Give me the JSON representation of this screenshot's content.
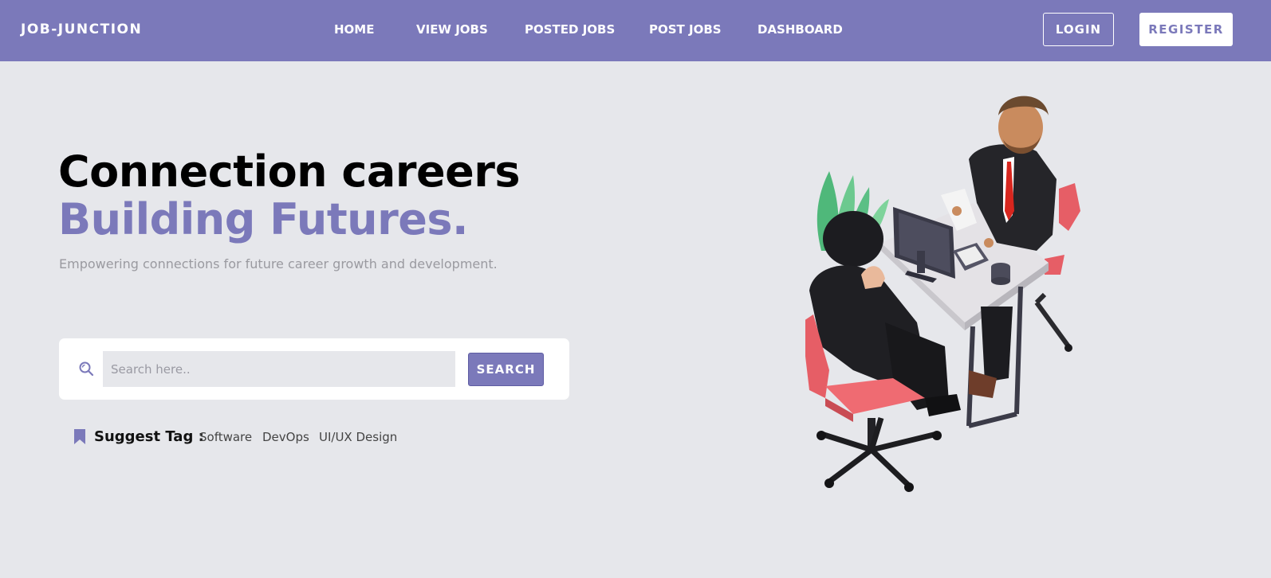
{
  "nav": {
    "brand": "JOB-JUNCTION",
    "links": [
      "HOME",
      "VIEW JOBS",
      "POSTED JOBS",
      "POST JOBS",
      "DASHBOARD"
    ],
    "login_label": "LOGIN",
    "register_label": "REGISTER"
  },
  "hero": {
    "title_line1": "Connection careers",
    "title_line2": "Building Futures.",
    "subtitle": "Empowering connections for future career growth and development."
  },
  "search": {
    "placeholder": "Search here..",
    "button_label": "SEARCH"
  },
  "suggest": {
    "label": "Suggest Tag :",
    "tags": [
      "Software",
      "DevOps",
      "UI/UX Design"
    ]
  },
  "colors": {
    "brand": "#7b79ba",
    "background": "#e6e7eb"
  }
}
